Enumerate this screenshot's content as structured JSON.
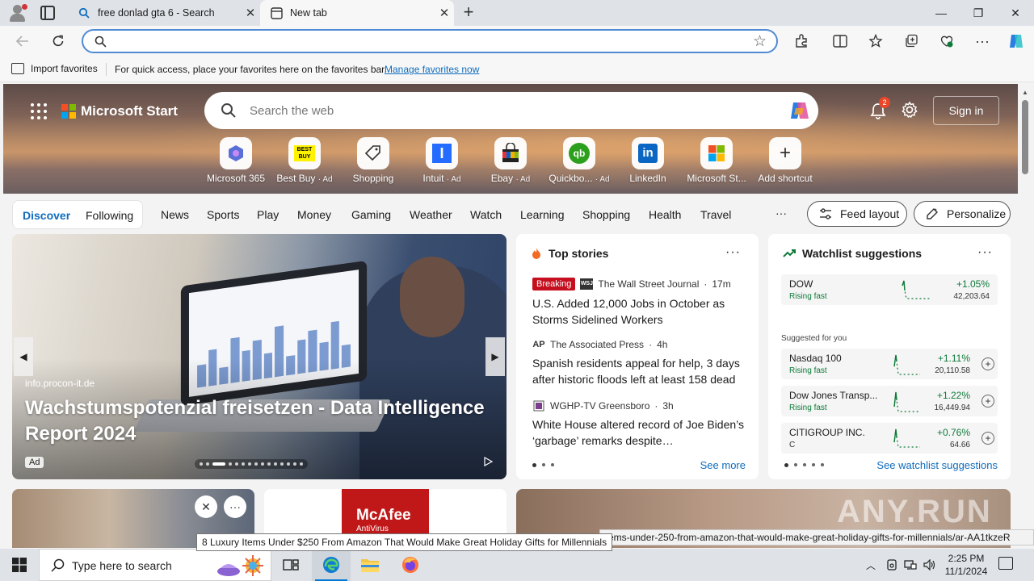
{
  "browser": {
    "tabs": [
      {
        "title": "free donlad gta 6 - Search"
      },
      {
        "title": "New tab"
      }
    ],
    "window_controls": {
      "minimize": "—",
      "restore": "❐",
      "close": "✕"
    }
  },
  "address_bar": {
    "value": "",
    "placeholder": ""
  },
  "favorites_bar": {
    "import": "Import favorites",
    "message": "For quick access, place your favorites here on the favorites bar.",
    "manage_link": "Manage favorites now"
  },
  "start": {
    "brand": "Microsoft Start",
    "search_placeholder": "Search the web",
    "notifications_count": "2",
    "sign_in": "Sign in",
    "shortcuts": [
      {
        "label": "Microsoft 365",
        "ad": ""
      },
      {
        "label": "Best Buy",
        "ad": "Ad"
      },
      {
        "label": "Shopping",
        "ad": ""
      },
      {
        "label": "Intuit",
        "ad": "Ad"
      },
      {
        "label": "Ebay",
        "ad": "Ad"
      },
      {
        "label": "Quickbo...",
        "ad": "Ad"
      },
      {
        "label": "LinkedIn",
        "ad": ""
      },
      {
        "label": "Microsoft St...",
        "ad": ""
      },
      {
        "label": "Add shortcut",
        "ad": ""
      }
    ],
    "shortcut_tile_text": {
      "bestbuy": "BEST BUY",
      "intuit": "I",
      "linkedin": "in",
      "qb": "qb"
    }
  },
  "nav": {
    "discover": "Discover",
    "following": "Following",
    "categories": [
      "News",
      "Sports",
      "Play",
      "Money",
      "Gaming",
      "Weather",
      "Watch",
      "Learning",
      "Shopping",
      "Health",
      "Travel"
    ],
    "more": "···",
    "feed_layout": "Feed layout",
    "personalize": "Personalize"
  },
  "carousel": {
    "source": "info.procon-it.de",
    "headline": "Wachstumspotenzial freisetzen - Data Intelligence Report 2024",
    "ad_label": "Ad",
    "prev": "◀",
    "next": "▶"
  },
  "top_stories": {
    "title": "Top stories",
    "more": "···",
    "stories": [
      {
        "badge": "Breaking",
        "logo": "WSJ",
        "publisher": "The Wall Street Journal",
        "time": "17m",
        "headline": "U.S. Added 12,000 Jobs in October as Storms Sidelined Workers"
      },
      {
        "badge": "",
        "logo": "AP",
        "publisher": "The Associated Press",
        "time": "4h",
        "headline": "Spanish residents appeal for help, 3 days after historic floods left at least 158 dead"
      },
      {
        "badge": "",
        "logo": "",
        "publisher": "WGHP-TV Greensboro",
        "time": "3h",
        "headline": "White House altered record of Joe Biden’s ‘garbage’ remarks despite…"
      }
    ],
    "see_more": "See more"
  },
  "watchlist": {
    "title": "Watchlist suggestions",
    "more": "···",
    "suggested_label": "Suggested for you",
    "stocks": [
      {
        "name": "DOW",
        "status": "Rising fast",
        "change": "+1.05%",
        "value": "42,203.64",
        "addable": false
      },
      {
        "name": "Nasdaq 100",
        "status": "Rising fast",
        "change": "+1.11%",
        "value": "20,110.58",
        "addable": true
      },
      {
        "name": "Dow Jones Transp...",
        "status": "Rising fast",
        "change": "+1.22%",
        "value": "16,449.94",
        "addable": true
      },
      {
        "name": "CITIGROUP INC.",
        "status": "C",
        "change": "+0.76%",
        "value": "64.66",
        "addable": true
      }
    ],
    "see_link": "See watchlist suggestions"
  },
  "bottom_cards": {
    "mcafee_brand": "McAfee",
    "mcafee_product": "AntiVirus"
  },
  "status_url": "items-under-250-from-amazon-that-would-make-great-holiday-gifts-for-millennials/ar-AA1tkzeR",
  "tooltip": "8 Luxury Items Under $250 From Amazon That Would Make Great Holiday Gifts for Millennials",
  "watermark": "ANY.RUN",
  "taskbar": {
    "search_placeholder": "Type here to search",
    "time": "2:25 PM",
    "date": "11/1/2024"
  }
}
